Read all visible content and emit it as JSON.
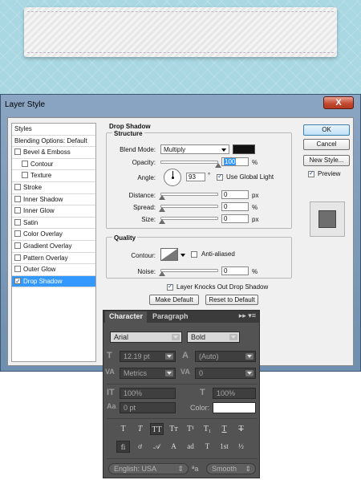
{
  "dialog": {
    "title": "Layer Style",
    "close_glyph": "X"
  },
  "styles_list": {
    "items": [
      {
        "label": "Styles",
        "checkbox": false,
        "indent": false,
        "selected": false
      },
      {
        "label": "Blending Options: Default",
        "checkbox": false,
        "indent": false,
        "selected": false
      },
      {
        "label": "Bevel & Emboss",
        "checkbox": true,
        "checked": false,
        "indent": false,
        "selected": false
      },
      {
        "label": "Contour",
        "checkbox": true,
        "checked": false,
        "indent": true,
        "selected": false
      },
      {
        "label": "Texture",
        "checkbox": true,
        "checked": false,
        "indent": true,
        "selected": false
      },
      {
        "label": "Stroke",
        "checkbox": true,
        "checked": false,
        "indent": false,
        "selected": false
      },
      {
        "label": "Inner Shadow",
        "checkbox": true,
        "checked": false,
        "indent": false,
        "selected": false
      },
      {
        "label": "Inner Glow",
        "checkbox": true,
        "checked": false,
        "indent": false,
        "selected": false
      },
      {
        "label": "Satin",
        "checkbox": true,
        "checked": false,
        "indent": false,
        "selected": false
      },
      {
        "label": "Color Overlay",
        "checkbox": true,
        "checked": false,
        "indent": false,
        "selected": false
      },
      {
        "label": "Gradient Overlay",
        "checkbox": true,
        "checked": false,
        "indent": false,
        "selected": false
      },
      {
        "label": "Pattern Overlay",
        "checkbox": true,
        "checked": false,
        "indent": false,
        "selected": false
      },
      {
        "label": "Outer Glow",
        "checkbox": true,
        "checked": false,
        "indent": false,
        "selected": false
      },
      {
        "label": "Drop Shadow",
        "checkbox": true,
        "checked": true,
        "indent": false,
        "selected": true
      }
    ]
  },
  "drop_shadow": {
    "heading": "Drop Shadow",
    "structure": {
      "heading": "Structure",
      "blend_mode_label": "Blend Mode:",
      "blend_mode_value": "Multiply",
      "shadow_color": "#121212",
      "opacity_label": "Opacity:",
      "opacity_value": "100",
      "opacity_level": 1.0,
      "percent_unit": "%",
      "angle_label": "Angle:",
      "angle_value": "93",
      "degree_unit": "°",
      "use_global_light_label": "Use Global Light",
      "use_global_light_checked": true,
      "distance_label": "Distance:",
      "distance_value": "0",
      "spread_label": "Spread:",
      "spread_value": "0",
      "size_label": "Size:",
      "size_value": "0",
      "px_unit": "px"
    },
    "quality": {
      "heading": "Quality",
      "contour_label": "Contour:",
      "anti_aliased_label": "Anti-aliased",
      "anti_aliased_checked": false,
      "noise_label": "Noise:",
      "noise_value": "0",
      "percent_unit": "%"
    },
    "layer_knocks_out_label": "Layer Knocks Out Drop Shadow",
    "layer_knocks_out_checked": true,
    "make_default_label": "Make Default",
    "reset_to_default_label": "Reset to Default"
  },
  "right_buttons": {
    "ok_label": "OK",
    "cancel_label": "Cancel",
    "new_style_label": "New Style...",
    "preview_label": "Preview",
    "preview_checked": true
  },
  "character_panel": {
    "tabs": [
      {
        "label": "Character",
        "active": true
      },
      {
        "label": "Paragraph",
        "active": false
      }
    ],
    "menu_glyphs": "▸▸ ▾≡",
    "font_family": "Arial",
    "font_style": "Bold",
    "font_size": "12.19 pt",
    "leading": "(Auto)",
    "kerning": "Metrics",
    "tracking": "0",
    "vertical_scale": "100%",
    "horizontal_scale": "100%",
    "baseline_shift": "0 pt",
    "color_label": "Color:",
    "text_color": "#ffffff",
    "type_style_buttons": [
      "T",
      "T",
      "TT",
      "Tт",
      "T¹",
      "T₁",
      "T",
      "T"
    ],
    "opentype_buttons": [
      "fi",
      "ơ",
      "𝒜",
      "A",
      "ad",
      "T",
      "1st",
      "½"
    ],
    "language": "English: USA",
    "aa_label": "ªa",
    "antialias": "Smooth"
  }
}
